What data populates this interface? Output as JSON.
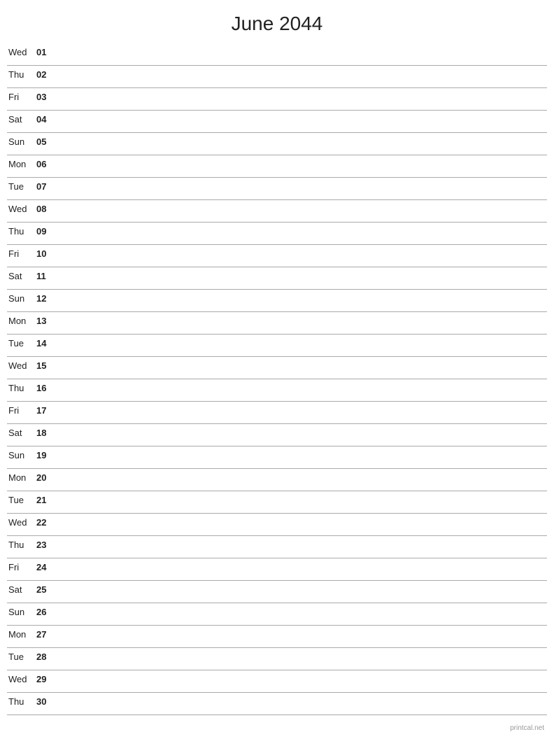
{
  "title": "June 2044",
  "footer": "printcal.net",
  "days": [
    {
      "name": "Wed",
      "number": "01"
    },
    {
      "name": "Thu",
      "number": "02"
    },
    {
      "name": "Fri",
      "number": "03"
    },
    {
      "name": "Sat",
      "number": "04"
    },
    {
      "name": "Sun",
      "number": "05"
    },
    {
      "name": "Mon",
      "number": "06"
    },
    {
      "name": "Tue",
      "number": "07"
    },
    {
      "name": "Wed",
      "number": "08"
    },
    {
      "name": "Thu",
      "number": "09"
    },
    {
      "name": "Fri",
      "number": "10"
    },
    {
      "name": "Sat",
      "number": "11"
    },
    {
      "name": "Sun",
      "number": "12"
    },
    {
      "name": "Mon",
      "number": "13"
    },
    {
      "name": "Tue",
      "number": "14"
    },
    {
      "name": "Wed",
      "number": "15"
    },
    {
      "name": "Thu",
      "number": "16"
    },
    {
      "name": "Fri",
      "number": "17"
    },
    {
      "name": "Sat",
      "number": "18"
    },
    {
      "name": "Sun",
      "number": "19"
    },
    {
      "name": "Mon",
      "number": "20"
    },
    {
      "name": "Tue",
      "number": "21"
    },
    {
      "name": "Wed",
      "number": "22"
    },
    {
      "name": "Thu",
      "number": "23"
    },
    {
      "name": "Fri",
      "number": "24"
    },
    {
      "name": "Sat",
      "number": "25"
    },
    {
      "name": "Sun",
      "number": "26"
    },
    {
      "name": "Mon",
      "number": "27"
    },
    {
      "name": "Tue",
      "number": "28"
    },
    {
      "name": "Wed",
      "number": "29"
    },
    {
      "name": "Thu",
      "number": "30"
    }
  ]
}
